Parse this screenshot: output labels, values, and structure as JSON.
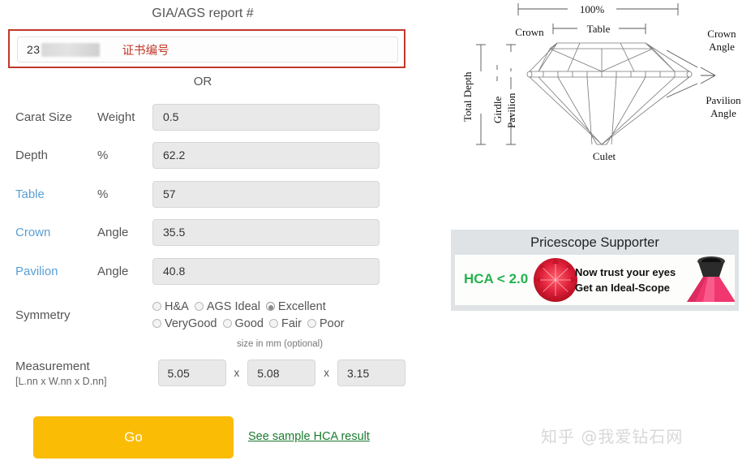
{
  "form": {
    "report_title": "GIA/AGS report #",
    "report_number_partial": "23",
    "report_hint_zh": "证书编号",
    "or_text": "OR",
    "rows": [
      {
        "label": "Carat Size",
        "unit": "Weight",
        "value": "0.5",
        "is_link": false
      },
      {
        "label": "Depth",
        "unit": "%",
        "value": "62.2",
        "is_link": false
      },
      {
        "label": "Table",
        "unit": "%",
        "value": "57",
        "is_link": true
      },
      {
        "label": "Crown",
        "unit": "Angle",
        "value": "35.5",
        "is_link": true
      },
      {
        "label": "Pavilion",
        "unit": "Angle",
        "value": "40.8",
        "is_link": true
      }
    ],
    "symmetry": {
      "label": "Symmetry",
      "row1": [
        {
          "label": "H&A",
          "selected": false
        },
        {
          "label": "AGS Ideal",
          "selected": false
        },
        {
          "label": "Excellent",
          "selected": true
        }
      ],
      "row2": [
        {
          "label": "VeryGood",
          "selected": false
        },
        {
          "label": "Good",
          "selected": false
        },
        {
          "label": "Fair",
          "selected": false
        },
        {
          "label": "Poor",
          "selected": false
        }
      ]
    },
    "size_note": "size in mm (optional)",
    "measurement": {
      "label": "Measurement",
      "sublabel": "[L.nn x W.nn x D.nn]",
      "length": "5.05",
      "width": "5.08",
      "depth": "3.15",
      "separator": "x"
    },
    "go_label": "Go",
    "sample_link": "See sample HCA result"
  },
  "diagram": {
    "top_span": "100%",
    "table": "Table",
    "crown": "Crown",
    "crown_angle_line1": "Crown",
    "crown_angle_line2": "Angle",
    "pavilion_angle_line1": "Pavilion",
    "pavilion_angle_line2": "Angle",
    "total_depth": "Total Depth",
    "girdle": "Girdle",
    "pavilion": "Pavilion",
    "culet": "Culet"
  },
  "banner": {
    "title": "Pricescope Supporter",
    "hca_text": "HCA < 2.0",
    "ad_line1": "Now trust your eyes",
    "ad_line2": "Get an Ideal-Scope"
  },
  "watermark": "知乎 @我爱钻石网",
  "colors": {
    "accent_red": "#c0392b",
    "link_blue": "#5a9fd4",
    "go_yellow": "#fbbc05",
    "green_link": "#197a2e",
    "hca_green": "#24b24c",
    "banner_bg": "#dfe3e6"
  }
}
